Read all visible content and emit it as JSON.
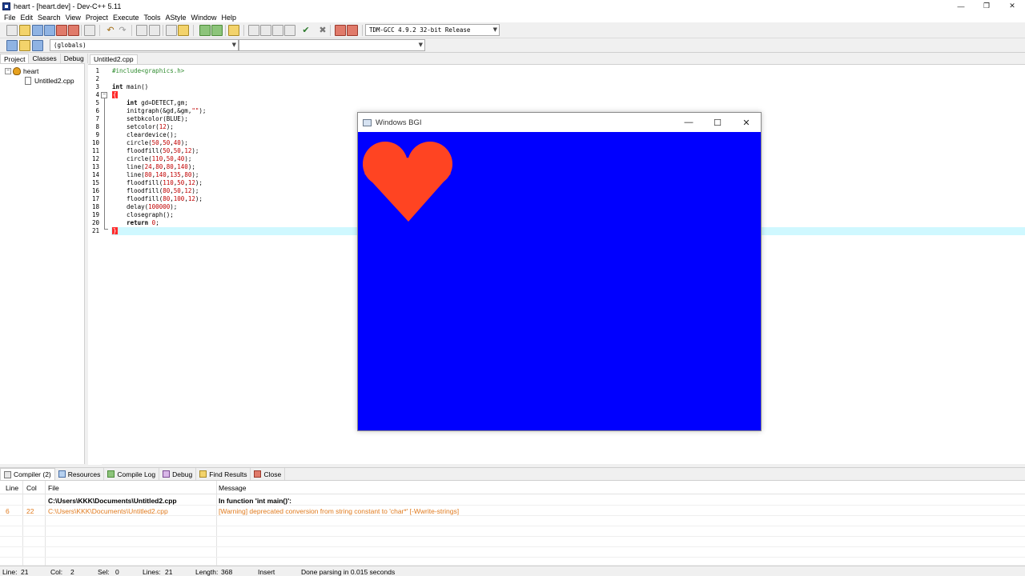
{
  "window": {
    "title": "heart - [heart.dev] - Dev-C++ 5.11"
  },
  "menu": [
    "File",
    "Edit",
    "Search",
    "View",
    "Project",
    "Execute",
    "Tools",
    "AStyle",
    "Window",
    "Help"
  ],
  "toolbar": {
    "compiler": "TDM-GCC 4.9.2 32-bit Release",
    "scope": "(globals)",
    "function": ""
  },
  "left_tabs": [
    "Project",
    "Classes",
    "Debug"
  ],
  "project_tree": {
    "project": "heart",
    "file": "Untitled2.cpp"
  },
  "editor": {
    "tab": "Untitled2.cpp",
    "lines": [
      "#include<graphics.h>",
      "",
      "int main()",
      "{",
      "    int gd=DETECT,gm;",
      "    initgraph(&gd,&gm,\"\");",
      "    setbkcolor(BLUE);",
      "    setcolor(12);",
      "    cleardevice();",
      "    circle(50,50,40);",
      "    floodfill(50,50,12);",
      "    circle(110,50,40);",
      "    line(24,80,80,140);",
      "    line(80,140,135,80);",
      "    floodfill(110,50,12);",
      "    floodfill(80,50,12);",
      "    floodfill(80,100,12);",
      "    delay(100000);",
      "    closegraph();",
      "    return 0;",
      "}"
    ]
  },
  "bgi_window": {
    "title": "Windows BGI",
    "background": "#0000ff",
    "heart_color": "#ff4422"
  },
  "bottom_tabs": [
    "Compiler (2)",
    "Resources",
    "Compile Log",
    "Debug",
    "Find Results",
    "Close"
  ],
  "messages": {
    "columns": [
      "Line",
      "Col",
      "File",
      "Message"
    ],
    "rows": [
      {
        "line": "",
        "col": "",
        "file": "C:\\Users\\KKK\\Documents\\Untitled2.cpp",
        "message": "In function 'int main()':"
      },
      {
        "line": "6",
        "col": "22",
        "file": "C:\\Users\\KKK\\Documents\\Untitled2.cpp",
        "message": "[Warning] deprecated conversion from string constant to 'char*' [-Wwrite-strings]"
      }
    ]
  },
  "status": {
    "line_label": "Line:",
    "line_val": "21",
    "col_label": "Col:",
    "col_val": "2",
    "sel_label": "Sel:",
    "sel_val": "0",
    "lines_label": "Lines:",
    "lines_val": "21",
    "length_label": "Length:",
    "length_val": "368",
    "mode": "Insert",
    "message": "Done parsing in 0.015 seconds"
  }
}
